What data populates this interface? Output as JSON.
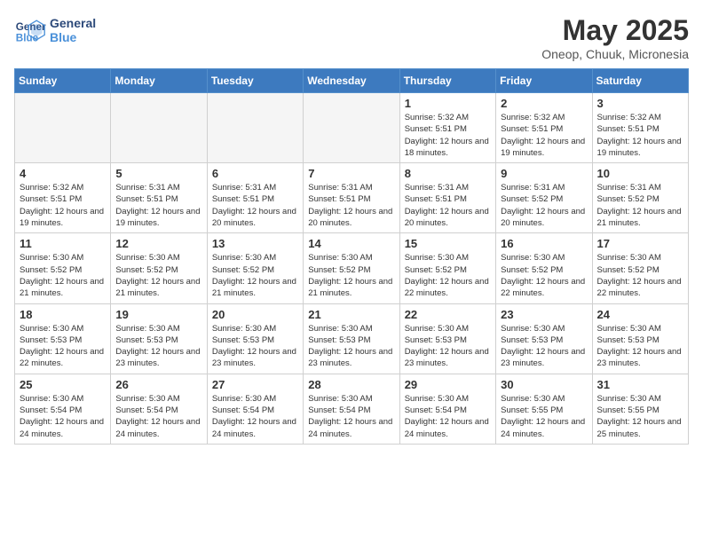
{
  "header": {
    "logo_line1": "General",
    "logo_line2": "Blue",
    "title": "May 2025",
    "subtitle": "Oneop, Chuuk, Micronesia"
  },
  "days_of_week": [
    "Sunday",
    "Monday",
    "Tuesday",
    "Wednesday",
    "Thursday",
    "Friday",
    "Saturday"
  ],
  "weeks": [
    [
      {
        "day": "",
        "empty": true
      },
      {
        "day": "",
        "empty": true
      },
      {
        "day": "",
        "empty": true
      },
      {
        "day": "",
        "empty": true
      },
      {
        "day": "1",
        "rise": "5:32 AM",
        "set": "5:51 PM",
        "daylight": "12 hours and 18 minutes."
      },
      {
        "day": "2",
        "rise": "5:32 AM",
        "set": "5:51 PM",
        "daylight": "12 hours and 19 minutes."
      },
      {
        "day": "3",
        "rise": "5:32 AM",
        "set": "5:51 PM",
        "daylight": "12 hours and 19 minutes."
      }
    ],
    [
      {
        "day": "4",
        "rise": "5:32 AM",
        "set": "5:51 PM",
        "daylight": "12 hours and 19 minutes."
      },
      {
        "day": "5",
        "rise": "5:31 AM",
        "set": "5:51 PM",
        "daylight": "12 hours and 19 minutes."
      },
      {
        "day": "6",
        "rise": "5:31 AM",
        "set": "5:51 PM",
        "daylight": "12 hours and 20 minutes."
      },
      {
        "day": "7",
        "rise": "5:31 AM",
        "set": "5:51 PM",
        "daylight": "12 hours and 20 minutes."
      },
      {
        "day": "8",
        "rise": "5:31 AM",
        "set": "5:51 PM",
        "daylight": "12 hours and 20 minutes."
      },
      {
        "day": "9",
        "rise": "5:31 AM",
        "set": "5:52 PM",
        "daylight": "12 hours and 20 minutes."
      },
      {
        "day": "10",
        "rise": "5:31 AM",
        "set": "5:52 PM",
        "daylight": "12 hours and 21 minutes."
      }
    ],
    [
      {
        "day": "11",
        "rise": "5:30 AM",
        "set": "5:52 PM",
        "daylight": "12 hours and 21 minutes."
      },
      {
        "day": "12",
        "rise": "5:30 AM",
        "set": "5:52 PM",
        "daylight": "12 hours and 21 minutes."
      },
      {
        "day": "13",
        "rise": "5:30 AM",
        "set": "5:52 PM",
        "daylight": "12 hours and 21 minutes."
      },
      {
        "day": "14",
        "rise": "5:30 AM",
        "set": "5:52 PM",
        "daylight": "12 hours and 21 minutes."
      },
      {
        "day": "15",
        "rise": "5:30 AM",
        "set": "5:52 PM",
        "daylight": "12 hours and 22 minutes."
      },
      {
        "day": "16",
        "rise": "5:30 AM",
        "set": "5:52 PM",
        "daylight": "12 hours and 22 minutes."
      },
      {
        "day": "17",
        "rise": "5:30 AM",
        "set": "5:52 PM",
        "daylight": "12 hours and 22 minutes."
      }
    ],
    [
      {
        "day": "18",
        "rise": "5:30 AM",
        "set": "5:53 PM",
        "daylight": "12 hours and 22 minutes."
      },
      {
        "day": "19",
        "rise": "5:30 AM",
        "set": "5:53 PM",
        "daylight": "12 hours and 23 minutes."
      },
      {
        "day": "20",
        "rise": "5:30 AM",
        "set": "5:53 PM",
        "daylight": "12 hours and 23 minutes."
      },
      {
        "day": "21",
        "rise": "5:30 AM",
        "set": "5:53 PM",
        "daylight": "12 hours and 23 minutes."
      },
      {
        "day": "22",
        "rise": "5:30 AM",
        "set": "5:53 PM",
        "daylight": "12 hours and 23 minutes."
      },
      {
        "day": "23",
        "rise": "5:30 AM",
        "set": "5:53 PM",
        "daylight": "12 hours and 23 minutes."
      },
      {
        "day": "24",
        "rise": "5:30 AM",
        "set": "5:53 PM",
        "daylight": "12 hours and 23 minutes."
      }
    ],
    [
      {
        "day": "25",
        "rise": "5:30 AM",
        "set": "5:54 PM",
        "daylight": "12 hours and 24 minutes."
      },
      {
        "day": "26",
        "rise": "5:30 AM",
        "set": "5:54 PM",
        "daylight": "12 hours and 24 minutes."
      },
      {
        "day": "27",
        "rise": "5:30 AM",
        "set": "5:54 PM",
        "daylight": "12 hours and 24 minutes."
      },
      {
        "day": "28",
        "rise": "5:30 AM",
        "set": "5:54 PM",
        "daylight": "12 hours and 24 minutes."
      },
      {
        "day": "29",
        "rise": "5:30 AM",
        "set": "5:54 PM",
        "daylight": "12 hours and 24 minutes."
      },
      {
        "day": "30",
        "rise": "5:30 AM",
        "set": "5:55 PM",
        "daylight": "12 hours and 24 minutes."
      },
      {
        "day": "31",
        "rise": "5:30 AM",
        "set": "5:55 PM",
        "daylight": "12 hours and 25 minutes."
      }
    ]
  ],
  "labels": {
    "sunrise": "Sunrise:",
    "sunset": "Sunset:",
    "daylight": "Daylight hours"
  }
}
